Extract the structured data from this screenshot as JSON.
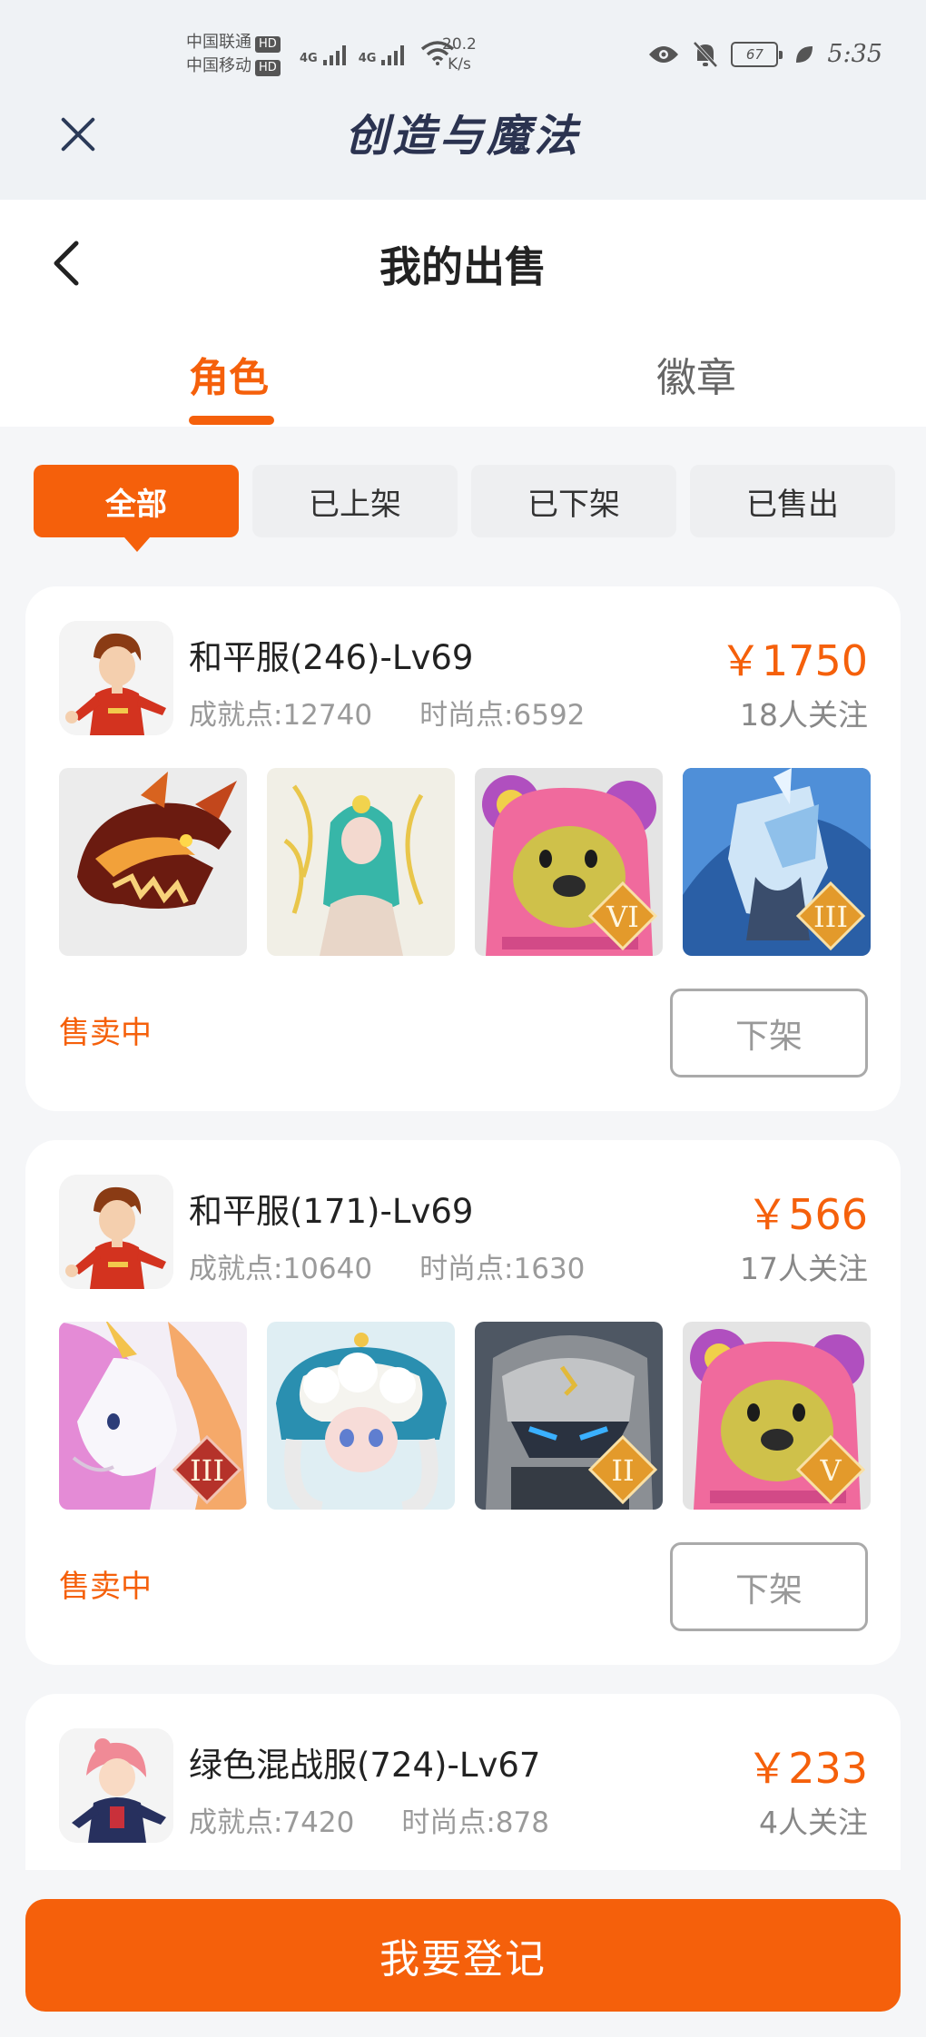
{
  "status_bar": {
    "carrier1": "中国联通",
    "carrier2": "中国移动",
    "hd": "HD",
    "net": "4G",
    "speed_value": "20.2",
    "speed_unit": "K/s",
    "battery": "67",
    "time": "5:35"
  },
  "app": {
    "title": "创造与魔法"
  },
  "page": {
    "title": "我的出售"
  },
  "tabs": [
    {
      "label": "角色",
      "active": true
    },
    {
      "label": "徽章",
      "active": false
    }
  ],
  "filters": [
    {
      "label": "全部",
      "active": true
    },
    {
      "label": "已上架"
    },
    {
      "label": "已下架"
    },
    {
      "label": "已售出"
    }
  ],
  "listings": [
    {
      "name": "和平服(246)-Lv69",
      "achievement": "成就点:12740",
      "fashion": "时尚点:6592",
      "price": "￥1750",
      "followers": "18人关注",
      "status": "售卖中",
      "action": "下架",
      "thumbs": [
        "dragon",
        "sea-goddess",
        "pink-bear",
        "ice-knight"
      ],
      "badges": [
        "",
        "",
        "VI",
        "III"
      ]
    },
    {
      "name": "和平服(171)-Lv69",
      "achievement": "成就点:10640",
      "fashion": "时尚点:1630",
      "price": "￥566",
      "followers": "17人关注",
      "status": "售卖中",
      "action": "下架",
      "thumbs": [
        "unicorn",
        "cloud-girl",
        "stone-golem",
        "pink-bear"
      ],
      "badges": [
        "III",
        "",
        "II",
        "V"
      ]
    },
    {
      "name": "绿色混战服(724)-Lv67",
      "achievement": "成就点:7420",
      "fashion": "时尚点:878",
      "price": "￥233",
      "followers": "4人关注"
    }
  ],
  "register": {
    "label": "我要登记"
  },
  "colors": {
    "accent": "#f5600b",
    "title_navy": "#2b3350"
  }
}
